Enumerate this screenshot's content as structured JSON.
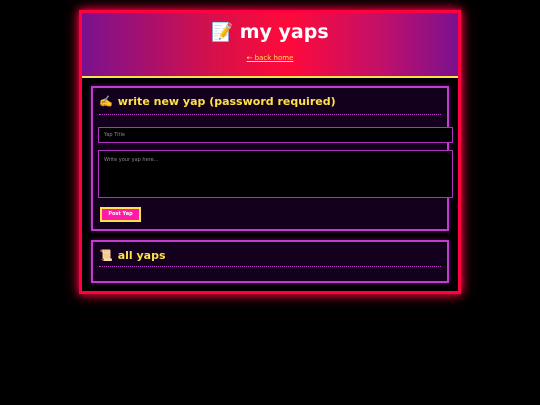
{
  "header": {
    "icon": "📝",
    "title": "my yaps",
    "back_link": "← back home"
  },
  "write_card": {
    "icon": "✍️",
    "title": "write new yap (password required)",
    "title_placeholder": "Yap Title",
    "body_placeholder": "Write your yap here...",
    "post_button": "Post Yap"
  },
  "list_card": {
    "icon": "📜",
    "title": "all yaps"
  },
  "colors": {
    "accent": "#ffe14a",
    "frame": "#ff0040",
    "card_border": "#c23cd1",
    "button": "#ff1aa8"
  }
}
